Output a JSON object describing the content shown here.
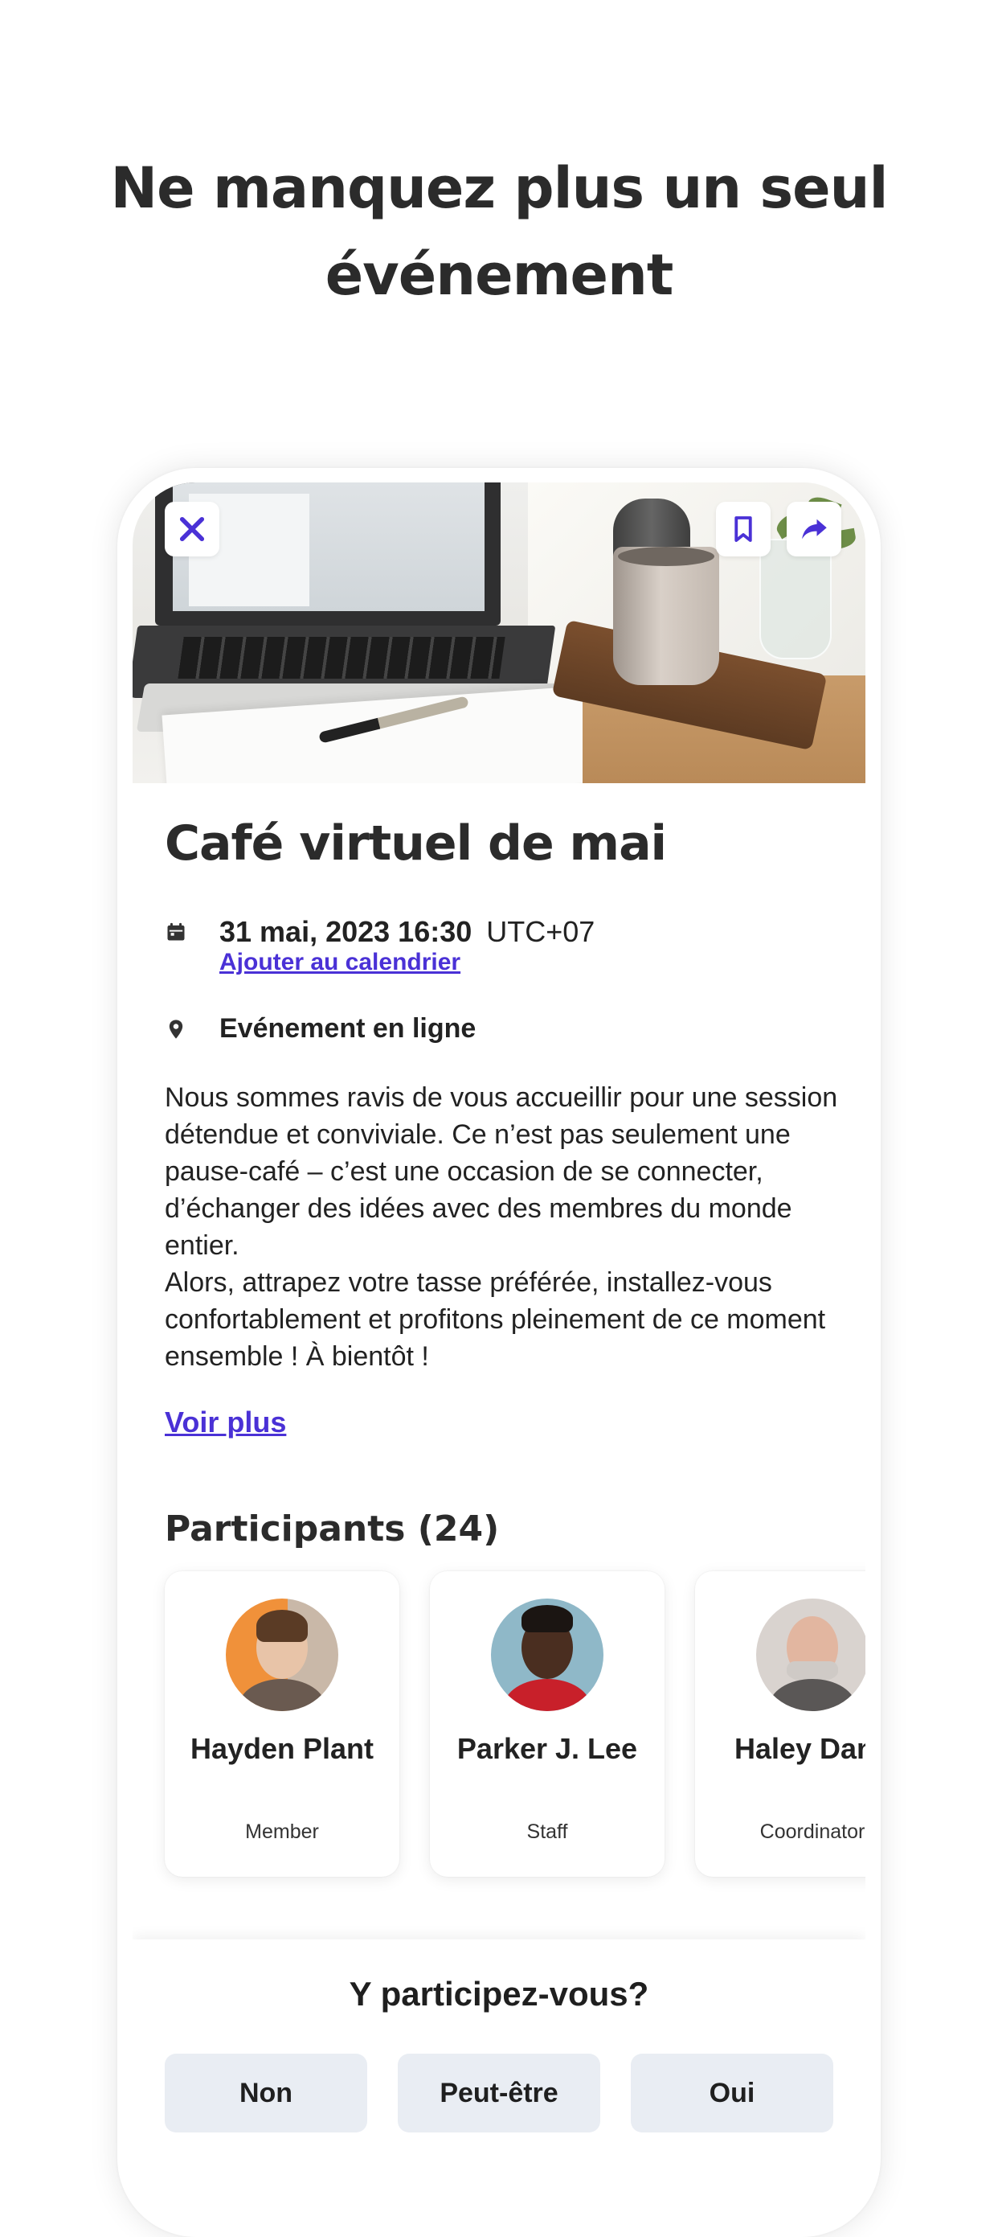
{
  "headline": {
    "line1": "Ne manquez plus un seul",
    "line2": "événement"
  },
  "event": {
    "title": "Café virtuel de mai",
    "date": "31 mai, 2023 16:30",
    "timezone": "UTC+07",
    "add_to_calendar": "Ajouter au calendrier",
    "location": "Evénement en ligne",
    "description": [
      "Nous sommes ravis de vous accueillir pour une session détendue et conviviale. Ce n’est pas seulement une pause-café – c’est une occasion de se connecter, d’échanger des idées avec des membres du monde entier.",
      "Alors, attrapez votre tasse préférée, installez-vous confortablement et profitons pleinement de ce moment ensemble ! À bientôt !"
    ],
    "see_more": "Voir plus"
  },
  "participants": {
    "title": "Participants (24)",
    "items": [
      {
        "name": "Hayden Plant",
        "role": "Member"
      },
      {
        "name": "Parker J. Lee",
        "role": "Staff"
      },
      {
        "name": "Haley Dane",
        "role": "Coordinator"
      }
    ]
  },
  "rsvp": {
    "question": "Y participez-vous?",
    "options": [
      "Non",
      "Peut-être",
      "Oui"
    ]
  },
  "icons": {
    "close": "close-icon",
    "bookmark": "bookmark-icon",
    "share": "share-icon",
    "calendar": "calendar-icon",
    "location": "location-pin-icon"
  },
  "colors": {
    "accent": "#4a31d6",
    "button_bg": "#e9edf3",
    "text": "#2b2b2b"
  }
}
